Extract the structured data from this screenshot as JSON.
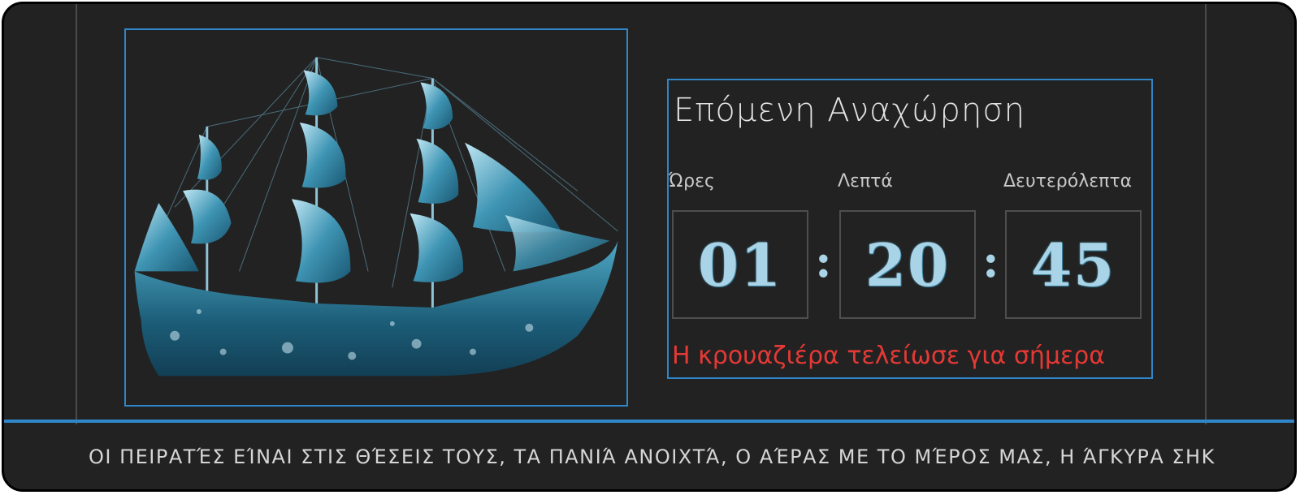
{
  "image": {
    "icon": "pirate-ship-illustration",
    "accent": "#5fb3cf"
  },
  "countdown": {
    "title": "Επόμενη Αναχώρηση",
    "labels": {
      "hours": "Ώρες",
      "minutes": "Λεπτά",
      "seconds": "Δευτερόλεπτα"
    },
    "values": {
      "hours": "01",
      "minutes": "20",
      "seconds": "45"
    },
    "separator": ":",
    "status": "Η κρουαζιέρα τελείωσε για σήμερα"
  },
  "ticker": {
    "text": "ΟΙ ΠΕΙΡΑΤΈΣ ΕΊΝΑΙ ΣΤΙΣ ΘΈΣΕΙΣ ΤΟΥΣ, ΤΑ ΠΑΝΙΆ ΑΝΟΙΧΤΆ, Ο ΑΈΡΑΣ ΜΕ ΤΟ ΜΈΡΟΣ ΜΑΣ, Η ΆΓΚΥΡΑ ΣΗΚ"
  },
  "colors": {
    "background": "#222222",
    "border_accent": "#2f86c8",
    "status": "#e53935",
    "digits": "#a9d3e6"
  }
}
